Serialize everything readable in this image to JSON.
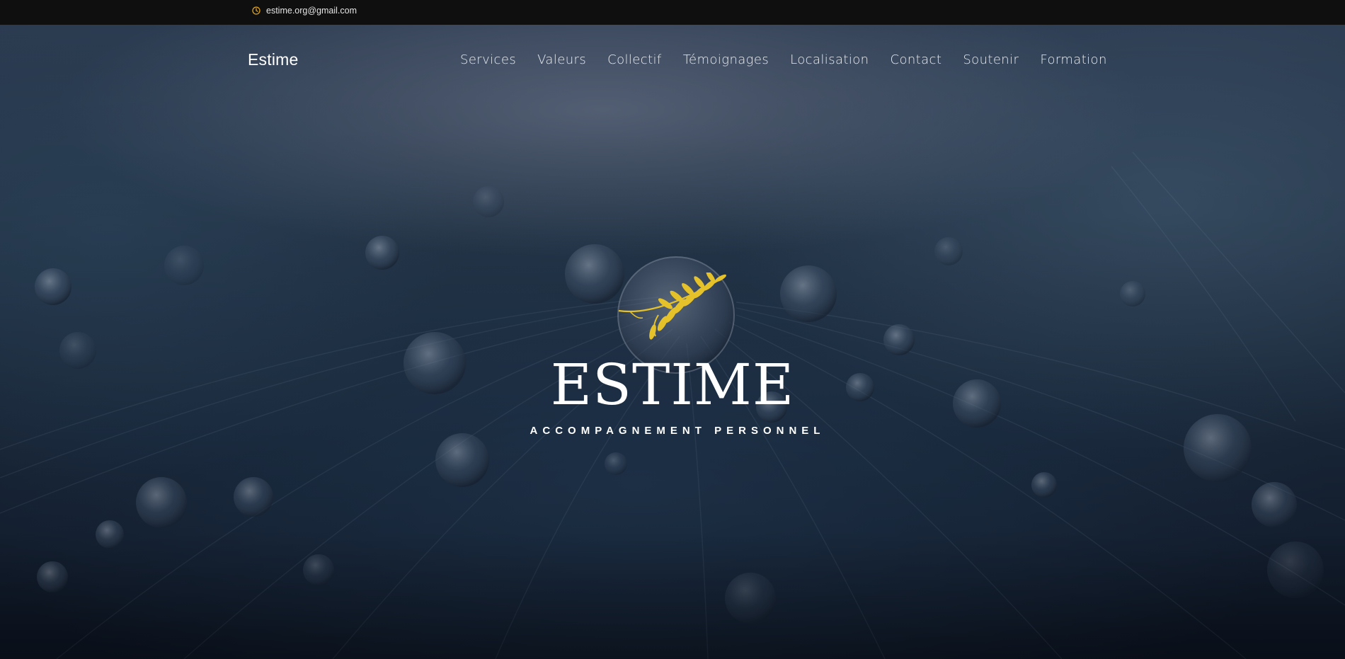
{
  "topbar": {
    "email": "estime.org@gmail.com",
    "icon": "clock-icon",
    "icon_color": "#e0a31a"
  },
  "navbar": {
    "brand": "Estime",
    "links": [
      {
        "label": "Services"
      },
      {
        "label": "Valeurs"
      },
      {
        "label": "Collectif"
      },
      {
        "label": "Témoignages"
      },
      {
        "label": "Localisation"
      },
      {
        "label": "Contact"
      },
      {
        "label": "Soutenir"
      },
      {
        "label": "Formation"
      }
    ]
  },
  "hero": {
    "title": "ESTIME",
    "subtitle": "ACCOMPAGNEMENT PERSONNEL",
    "logo_icon": "olive-branch-icon",
    "logo_color": "#e6c22a",
    "background": "water-droplets-on-feather-photo"
  }
}
